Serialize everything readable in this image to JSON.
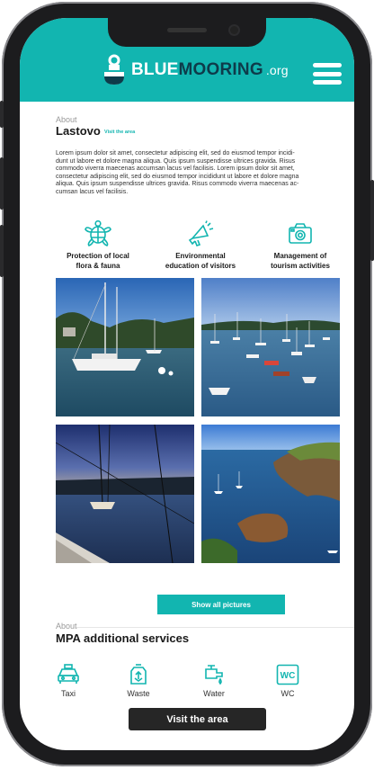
{
  "brand": {
    "blue": "BLUE",
    "mooring": "MOORING",
    "tld": ".org"
  },
  "about": {
    "eyebrow": "About",
    "title": "Lastovo",
    "link": "Visit the area",
    "lines": [
      "Lorem ipsum dolor sit amet, consectetur adipiscing elit, sed do eiusmod tempor incidi-",
      "dunt ut labore et dolore magna aliqua. Quis ipsum suspendisse ultrices gravida. Risus",
      "commodo viverra maecenas accumsan lacus vel facilisis. Lorem ipsum dolor sit amet,",
      "consectetur adipiscing elit, sed do eiusmod tempor incididunt ut labore et dolore magna",
      "aliqua. Quis ipsum suspendisse ultrices gravida. Risus commodo viverra maecenas ac-",
      "cumsan lacus vel facilisis."
    ]
  },
  "features": [
    {
      "icon": "turtle-icon",
      "label": "Protection of local\nflora & fauna"
    },
    {
      "icon": "megaphone-icon",
      "label": "Environmental\neducation of visitors"
    },
    {
      "icon": "camera-icon",
      "label": "Management of\ntourism activities"
    }
  ],
  "gallery": {
    "photos": [
      "sailboat-harbor-photo",
      "moored-boats-bay-photo",
      "sailboat-sunset-photo",
      "rocky-coast-photo"
    ],
    "show_all_label": "Show all pictures"
  },
  "services": {
    "eyebrow": "About",
    "title": "MPA additional services",
    "items": [
      {
        "icon": "taxi-icon",
        "label": "Taxi"
      },
      {
        "icon": "waste-icon",
        "label": "Waste"
      },
      {
        "icon": "water-tap-icon",
        "label": "Water"
      },
      {
        "icon": "wc-icon",
        "label": "WC"
      }
    ]
  },
  "visit_button": "Visit the area",
  "colors": {
    "accent": "#12b5b0",
    "dark": "#0e3b4a",
    "button_dark": "#262626"
  }
}
